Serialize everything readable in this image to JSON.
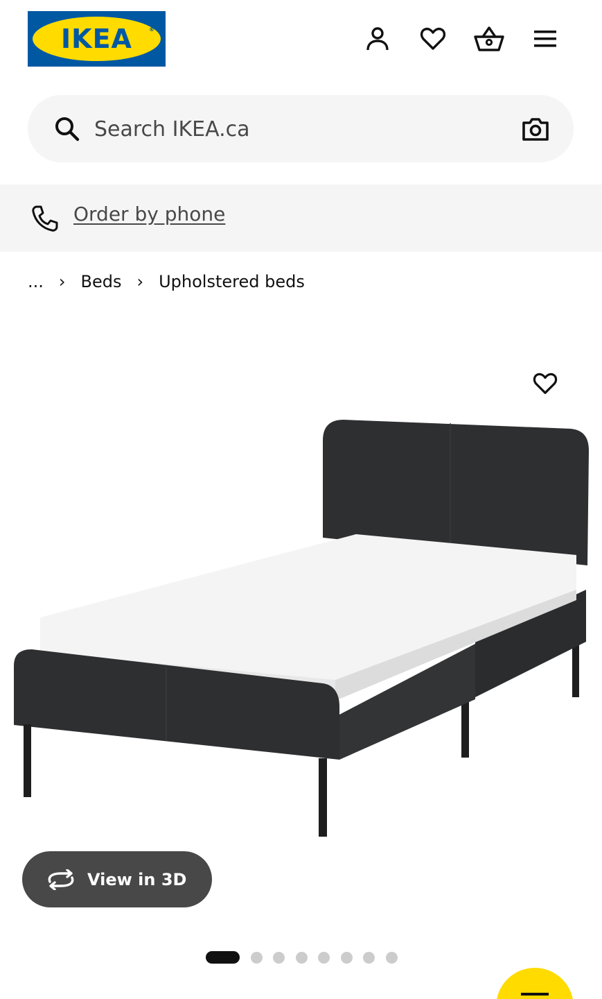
{
  "header": {
    "logo_text": "IKEA",
    "logo_reg": "®",
    "icons": [
      "user-icon",
      "heart-icon",
      "shopping-basket-icon",
      "menu-icon"
    ]
  },
  "search": {
    "placeholder": "Search IKEA.ca",
    "value": "",
    "search_icon": "search-icon",
    "camera_icon": "camera-icon"
  },
  "phone_banner": {
    "label": "Order by phone",
    "icon": "phone-icon"
  },
  "breadcrumb": {
    "items": [
      "...",
      "Beds",
      "Upholstered beds"
    ],
    "separator": "›"
  },
  "product": {
    "favorite_icon": "heart-icon",
    "view_3d_label": "View in 3D",
    "view_3d_icon": "rotate-3d-icon"
  },
  "carousel": {
    "total_images": 8,
    "active_index": 0
  },
  "colors": {
    "brand_blue": "#0058a3",
    "brand_yellow": "#ffdb00",
    "banner_gray": "#f5f5f5",
    "button_dark": "#484848"
  }
}
